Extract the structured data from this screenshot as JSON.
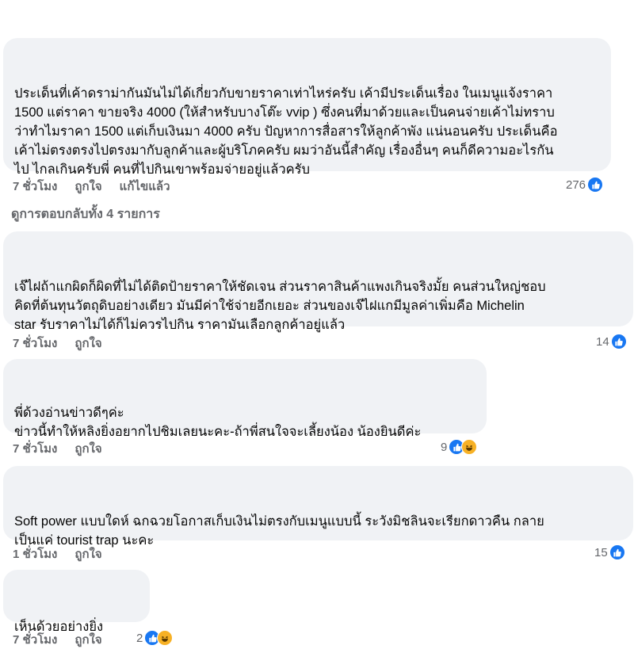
{
  "comments": [
    {
      "text": "ประเด็นที่เค้าดราม่ากันมันไม่ได้เกี่ยวกับขายราคาเท่าไหร่ครับ เค้ามีประเด็นเรื่อง ในเมนูแจ้งราคา\n1500 แต่ราคา ขายจริง 4000 (ให้สำหรับบางโต๊ะ vvip ) ซึ่งคนที่มาด้วยและเป็นคนจ่ายเค้าไม่ทราบ\nว่าทำไมราคา 1500 แต่เก็บเงินมา 4000 ครับ ปัญหาการสื่อสารให้ลูกค้าพัง แน่นอนครับ ประเด็นคือ\nเค้าไม่ตรงตรงไปตรงมากับลูกค้าและผู้บริโภคครับ ผมว่าอันนี้สำคัญ เรื่องอื่นๆ คนก็ดีความอะไรกัน\nไป ไกลเกินครับพี่ คนที่ไปกินเขาพร้อมจ่ายอยู่แล้วครับ",
      "time": "7 ชั่วโมง",
      "like_action": "ถูกใจ",
      "edited": "แก้ไขแล้ว",
      "reaction_count": "276"
    },
    {
      "text": "เจ๊ไฝถ้าแกผิดก็ผิดที่ไม่ได้ติดป้ายราคาให้ชัดเจน ส่วนราคาสินค้าแพงเกินจริงมั้ย คนส่วนใหญ่ชอบ\nคิดที่ต้นทุนวัตถุดิบอย่างเดียว มันมีค่าใช้จ่ายอีกเยอะ ส่วนของเจ๊ไฝแกมีมูลค่าเพิ่มคือ Michelin\nstar รับราคาไม่ได้ก็ไม่ควรไปกิน ราคามันเลือกลูกค้าอยู่แล้ว",
      "time": "7 ชั่วโมง",
      "like_action": "ถูกใจ",
      "reaction_count": "14"
    },
    {
      "text": "พี่ด้วงอ่านข่าวดีๆค่ะ\nข่าวนี้ทำให้หลิงยิ่งอยากไปชิมเลยนะคะ-ถ้าพี่สนใจจะเลี้ยงน้อง น้องยินดีค่ะ",
      "time": "7 ชั่วโมง",
      "like_action": "ถูกใจ",
      "reaction_count": "9"
    },
    {
      "text": "Soft power แบบใดห์ ฉกฉวยโอกาสเก็บเงินไม่ตรงกับเมนูแบบนี้ ระวังมิชลินจะเรียกดาวคืน กลาย\nเป็นแค่ tourist trap นะคะ",
      "time": "1 ชั่วโมง",
      "like_action": "ถูกใจ",
      "reaction_count": "15"
    },
    {
      "text": "เห็นด้วยอย่างยิ่ง",
      "time": "7 ชั่วโมง",
      "like_action": "ถูกใจ",
      "reaction_count": "2"
    }
  ],
  "view_replies": "ดูการตอบกลับทั้ง 4 รายการ",
  "colors": {
    "bubble": "#f0f2f5",
    "meta": "#65676b",
    "like_blue": "#1877f2",
    "haha_yellow": "#f7b125"
  },
  "icons": [
    "like-icon",
    "haha-icon"
  ]
}
